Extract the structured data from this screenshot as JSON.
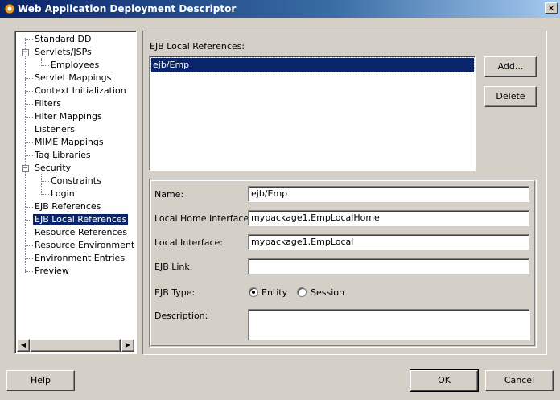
{
  "window": {
    "title": "Web Application Deployment Descriptor",
    "close_glyph": "✕"
  },
  "tree": {
    "items": [
      {
        "label": "Standard DD"
      },
      {
        "label": "Servlets/JSPs"
      },
      {
        "label": "Employees"
      },
      {
        "label": "Servlet Mappings"
      },
      {
        "label": "Context Initialization"
      },
      {
        "label": "Filters"
      },
      {
        "label": "Filter Mappings"
      },
      {
        "label": "Listeners"
      },
      {
        "label": "MIME Mappings"
      },
      {
        "label": "Tag Libraries"
      },
      {
        "label": "Security"
      },
      {
        "label": "Constraints"
      },
      {
        "label": "Login"
      },
      {
        "label": "EJB References"
      },
      {
        "label": "EJB Local References"
      },
      {
        "label": "Resource References"
      },
      {
        "label": "Resource Environment Re"
      },
      {
        "label": "Environment Entries"
      },
      {
        "label": "Preview"
      }
    ],
    "selected": "EJB Local References",
    "expand_glyph": "−",
    "scroll_left": "◀",
    "scroll_right": "▶"
  },
  "refs": {
    "title": "EJB Local References:",
    "items": [
      "ejb/Emp"
    ],
    "add_label": "Add...",
    "delete_label": "Delete"
  },
  "form": {
    "name_label": "Name:",
    "name_value": "ejb/Emp",
    "home_label": "Local Home Interface:",
    "home_value": "mypackage1.EmpLocalHome",
    "local_label": "Local Interface:",
    "local_value": "mypackage1.EmpLocal",
    "link_label": "EJB Link:",
    "link_value": "",
    "type_label": "EJB Type:",
    "type_entity": "Entity",
    "type_session": "Session",
    "type_selected": "Entity",
    "desc_label": "Description:",
    "desc_value": ""
  },
  "footer": {
    "help_label": "Help",
    "ok_label": "OK",
    "cancel_label": "Cancel"
  }
}
